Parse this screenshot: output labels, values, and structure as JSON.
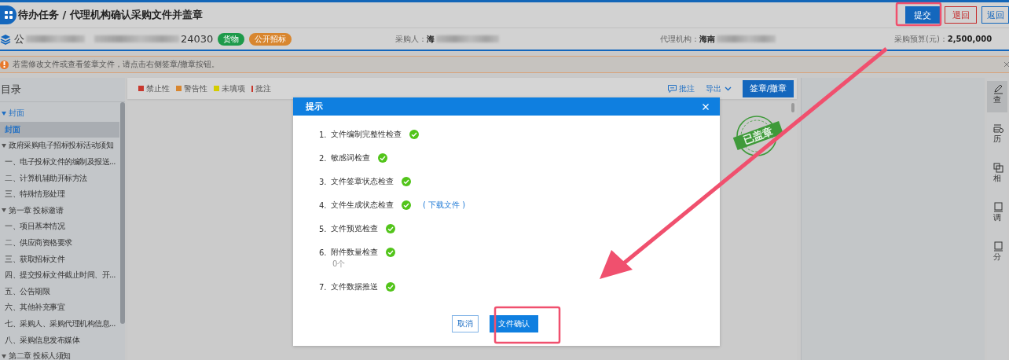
{
  "header": {
    "title": "待办任务 / 代理机构确认采购文件并盖章",
    "buttons": [
      {
        "label": "提交",
        "kind": "primary"
      },
      {
        "label": "退回",
        "kind": "danger"
      },
      {
        "label": "返回",
        "kind": "outline"
      }
    ]
  },
  "project": {
    "name_start": "公",
    "name_end": "24030",
    "tags": [
      {
        "label": "货物",
        "color": "#1e9a4a"
      },
      {
        "label": "公开招标",
        "color": "#d8862f"
      }
    ],
    "purchaser": {
      "label": "采购人：",
      "value": "海"
    },
    "agency": {
      "label": "代理机构：",
      "value": "海南"
    },
    "budget": {
      "label": "采购预算(元)：",
      "value": "2,500,000"
    }
  },
  "notice": {
    "text": "若需修改文件或查看签章文件，请点击右侧签章/撤章按钮。"
  },
  "toc": {
    "title": "目录",
    "items": [
      {
        "label": "封面",
        "expanded": true,
        "selected": false,
        "children": [
          {
            "label": "封面",
            "selected": true
          }
        ]
      },
      {
        "label": "政府采购电子招标投标活动须知",
        "expanded": true,
        "selected": false,
        "children": [
          {
            "label": "一、电子投标文件的编制及报送...",
            "selected": false
          },
          {
            "label": "二、计算机辅助开标方法",
            "selected": false
          },
          {
            "label": "三、特殊情形处理",
            "selected": false
          }
        ]
      },
      {
        "label": "第一章 投标邀请",
        "expanded": true,
        "selected": false,
        "children": [
          {
            "label": "一、项目基本情况",
            "selected": false
          },
          {
            "label": "二、供应商资格要求",
            "selected": false
          },
          {
            "label": "三、获取招标文件",
            "selected": false
          },
          {
            "label": "四、提交投标文件截止时间、开...",
            "selected": false
          },
          {
            "label": "五、公告期限",
            "selected": false
          },
          {
            "label": "六、其他补充事宜",
            "selected": false
          },
          {
            "label": "七、采购人、采购代理机构信息...",
            "selected": false
          },
          {
            "label": "八、采购信息发布媒体",
            "selected": false
          }
        ]
      },
      {
        "label": "第二章 投标人须知",
        "expanded": true,
        "selected": false
      }
    ]
  },
  "legend": [
    {
      "label": "禁止性",
      "kind": "square",
      "color": "#c8372d"
    },
    {
      "label": "警告性",
      "kind": "square",
      "color": "#d8862f"
    },
    {
      "label": "未填项",
      "kind": "square",
      "color": "#d4cc00"
    },
    {
      "label": "批注",
      "kind": "bar",
      "color": "#c8372d"
    }
  ],
  "doc_toolbar": {
    "comment": "批注",
    "export": "导出",
    "sign": "签章/撤章"
  },
  "stamp": {
    "text": "已盖章"
  },
  "right_rail": [
    {
      "label": "查",
      "selected": true
    },
    {
      "label": "历",
      "selected": false
    },
    {
      "label": "相",
      "selected": false
    },
    {
      "label": "调",
      "selected": false
    },
    {
      "label": "分",
      "selected": false
    }
  ],
  "dialog": {
    "title": "提示",
    "items": [
      {
        "number": "1.",
        "label": "文件编制完整性检查",
        "passed": true
      },
      {
        "number": "2.",
        "label": "敏感词检查",
        "passed": true
      },
      {
        "number": "3.",
        "label": "文件签章状态检查",
        "passed": true
      },
      {
        "number": "4.",
        "label": "文件生成状态检查",
        "passed": true,
        "link": "( 下载文件 )"
      },
      {
        "number": "5.",
        "label": "文件预览检查",
        "passed": true
      },
      {
        "number": "6.",
        "label": "附件数量检查",
        "passed": true,
        "note": "0个"
      },
      {
        "number": "7.",
        "label": "文件数据推送",
        "passed": true
      }
    ],
    "cancel": "取消",
    "confirm": "文件确认"
  }
}
